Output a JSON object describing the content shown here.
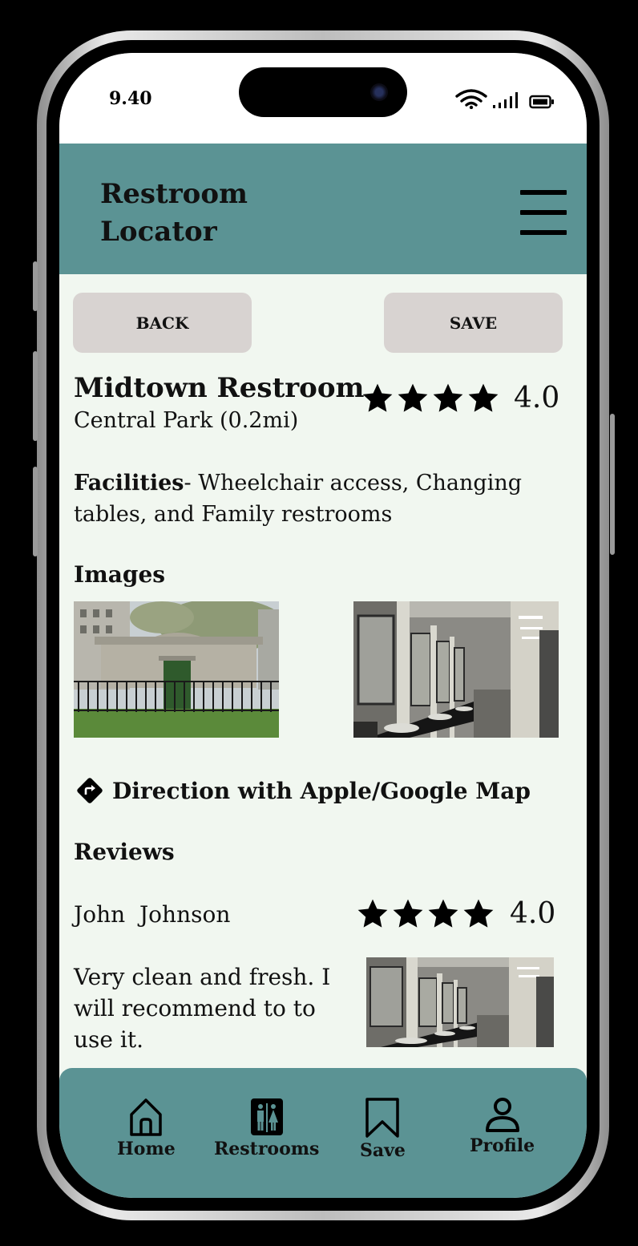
{
  "status_bar": {
    "time": "9.40"
  },
  "header": {
    "title_line1": "Restroom",
    "title_line2": "Locator"
  },
  "actions": {
    "back_label": "BACK",
    "save_label": "SAVE"
  },
  "place": {
    "name": "Midtown Restroom",
    "location": "Central Park (0.2mi)",
    "rating": "4.0",
    "stars_filled": 4
  },
  "facilities": {
    "label": "Facilities",
    "text": "- Wheelchair access, Changing tables, and Family restrooms"
  },
  "images": {
    "heading": "Images"
  },
  "direction": {
    "label": "Direction with Apple/Google Map"
  },
  "reviews": {
    "heading": "Reviews",
    "items": [
      {
        "author": "John  Johnson",
        "rating": "4.0",
        "stars_filled": 4,
        "text": "Very clean and fresh. I will recommend to to use it."
      }
    ]
  },
  "nav": {
    "items": [
      {
        "label": "Home",
        "icon": "home-icon"
      },
      {
        "label": "Restrooms",
        "icon": "restroom-icon"
      },
      {
        "label": "Save",
        "icon": "bookmark-icon"
      },
      {
        "label": "Profile",
        "icon": "profile-icon"
      }
    ]
  },
  "colors": {
    "header_bg": "#5b9394",
    "content_bg": "#f1f7f0",
    "button_bg": "#d8d3d1",
    "text": "#111111"
  }
}
